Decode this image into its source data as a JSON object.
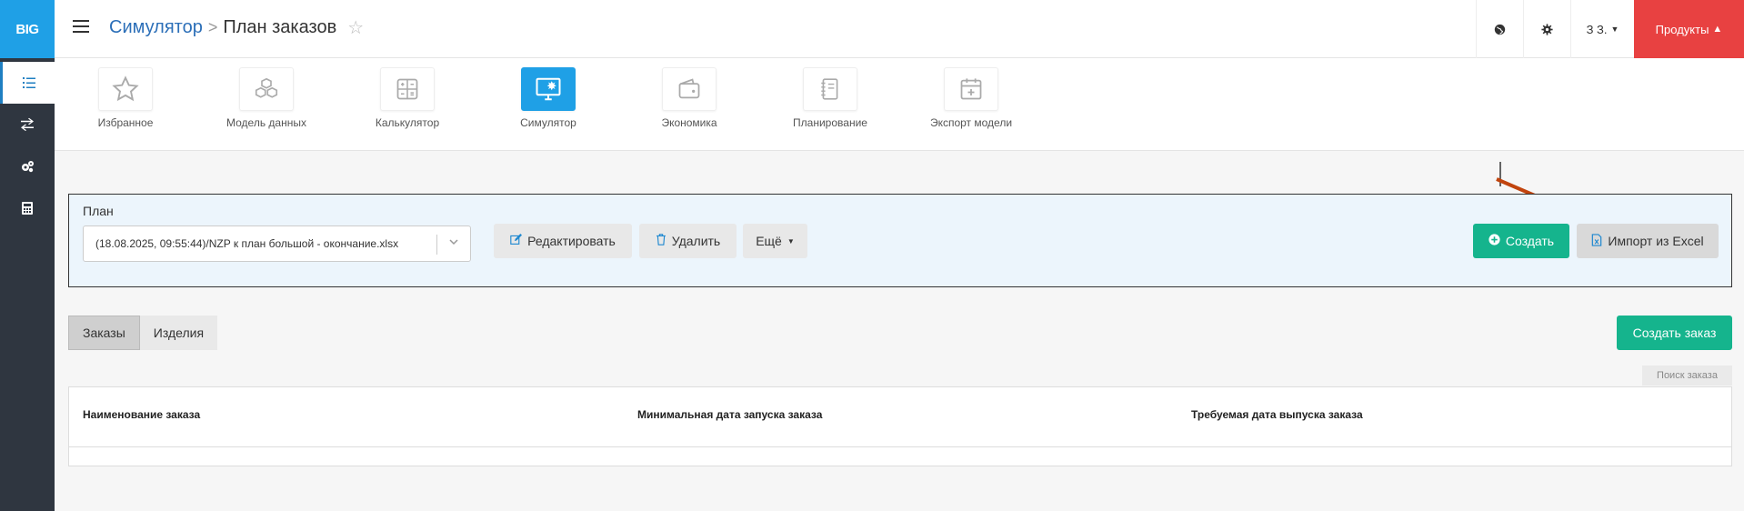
{
  "app": {
    "logo_text": "BIG",
    "accent": "#1fa0e6",
    "sidebar_color": "#2f3640",
    "sidebar": [
      {
        "name": "list-icon",
        "active": true
      },
      {
        "name": "transfer-icon",
        "active": false
      },
      {
        "name": "gears-icon",
        "active": false
      },
      {
        "name": "calculator-icon",
        "active": false
      }
    ]
  },
  "header": {
    "breadcrumb_parent": "Симулятор",
    "breadcrumb_separator": ">",
    "page_title": "План заказов",
    "star_glyph": "☆",
    "user_label": "З З.",
    "products_label": "Продукты",
    "products_color": "#e84141"
  },
  "modules": [
    {
      "label": "Избранное",
      "icon": "star-icon",
      "active": false
    },
    {
      "label": "Модель данных",
      "icon": "cubes-icon",
      "active": false
    },
    {
      "label": "Калькулятор",
      "icon": "calculator-icon",
      "active": false
    },
    {
      "label": "Симулятор",
      "icon": "monitor-icon",
      "active": true
    },
    {
      "label": "Экономика",
      "icon": "wallet-icon",
      "active": false
    },
    {
      "label": "Планирование",
      "icon": "notebook-icon",
      "active": false
    },
    {
      "label": "Экспорт модели",
      "icon": "calendar-plus-icon",
      "active": false
    }
  ],
  "plan": {
    "label": "План",
    "selected_value": "(18.08.2025, 09:55:44)/NZP к план большой - окончание.xlsx",
    "edit_label": "Редактировать",
    "delete_label": "Удалить",
    "more_label": "Ещё",
    "create_label": "Создать",
    "import_label": "Импорт из Excel"
  },
  "tabs": [
    {
      "label": "Заказы",
      "active": true
    },
    {
      "label": "Изделия",
      "active": false
    }
  ],
  "create_order_label": "Создать заказ",
  "search_placeholder": "Поиск заказа",
  "table": {
    "columns": [
      "Наименование заказа",
      "Минимальная дата запуска заказа",
      "Требуемая дата выпуска заказа"
    ]
  }
}
